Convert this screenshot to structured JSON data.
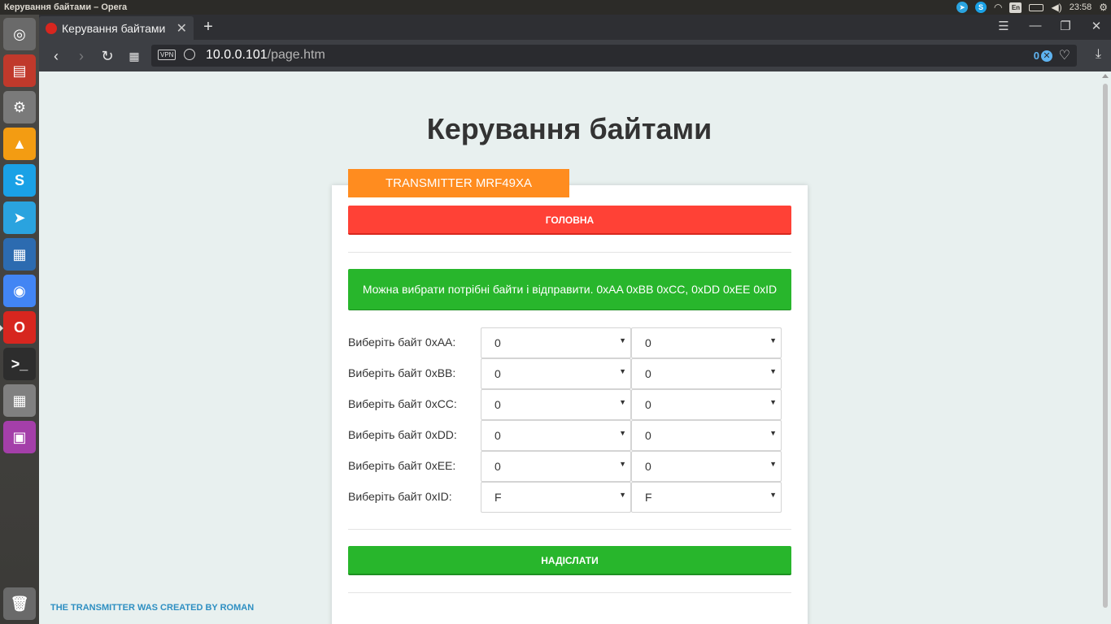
{
  "os": {
    "window_title": "Керування байтами – Opera",
    "time": "23:58",
    "keyboard_layout": "En"
  },
  "launcher": {
    "apps": [
      {
        "name": "ubuntu-dash",
        "color": "#6a6a6a",
        "glyph": "◎"
      },
      {
        "name": "files",
        "color": "#c0392b",
        "glyph": "▤"
      },
      {
        "name": "settings",
        "color": "#7a7a7a",
        "glyph": "⚙"
      },
      {
        "name": "vlc",
        "color": "#f39c12",
        "glyph": "▲"
      },
      {
        "name": "skype",
        "color": "#1aa1e6",
        "glyph": "S"
      },
      {
        "name": "telegram",
        "color": "#2aa3df",
        "glyph": "➤"
      },
      {
        "name": "libreoffice-writer",
        "color": "#2c6bb0",
        "glyph": "▦"
      },
      {
        "name": "chrome",
        "color": "#4285f4",
        "glyph": "◉"
      },
      {
        "name": "opera",
        "color": "#d7261f",
        "glyph": "O"
      },
      {
        "name": "terminal",
        "color": "#2d2d2d",
        "glyph": ">_"
      },
      {
        "name": "calculator",
        "color": "#808080",
        "glyph": "▦"
      },
      {
        "name": "remote-desktop",
        "color": "#a43fa9",
        "glyph": "▣"
      },
      {
        "name": "trash",
        "color": "#6a6a6a",
        "glyph": "🗑"
      }
    ]
  },
  "browser": {
    "tab_title": "Керування байтами",
    "url_host": "10.0.0.101",
    "url_path": "/page.htm",
    "vpn_label": "VPN",
    "adblock_count": "0"
  },
  "page": {
    "title": "Керування байтами",
    "badge": "TRANSMITTER MRF49XA",
    "home_button": "ГОЛОВНА",
    "info": "Можна вибрати потрібні байти і відправити. 0xAA 0xBB 0xCC, 0xDD 0xEE 0xID",
    "rows": [
      {
        "label": "Виберіть байт 0xAA:",
        "hi": "0",
        "lo": "0"
      },
      {
        "label": "Виберіть байт 0xBB:",
        "hi": "0",
        "lo": "0"
      },
      {
        "label": "Виберіть байт 0xCC:",
        "hi": "0",
        "lo": "0"
      },
      {
        "label": "Виберіть байт 0xDD:",
        "hi": "0",
        "lo": "0"
      },
      {
        "label": "Виберіть байт 0xEE:",
        "hi": "0",
        "lo": "0"
      },
      {
        "label": "Виберіть байт 0xID:",
        "hi": "F",
        "lo": "F"
      }
    ],
    "send_button": "НАДІСЛАТИ",
    "footer": "THE TRANSMITTER WAS CREATED BY ROMAN"
  }
}
